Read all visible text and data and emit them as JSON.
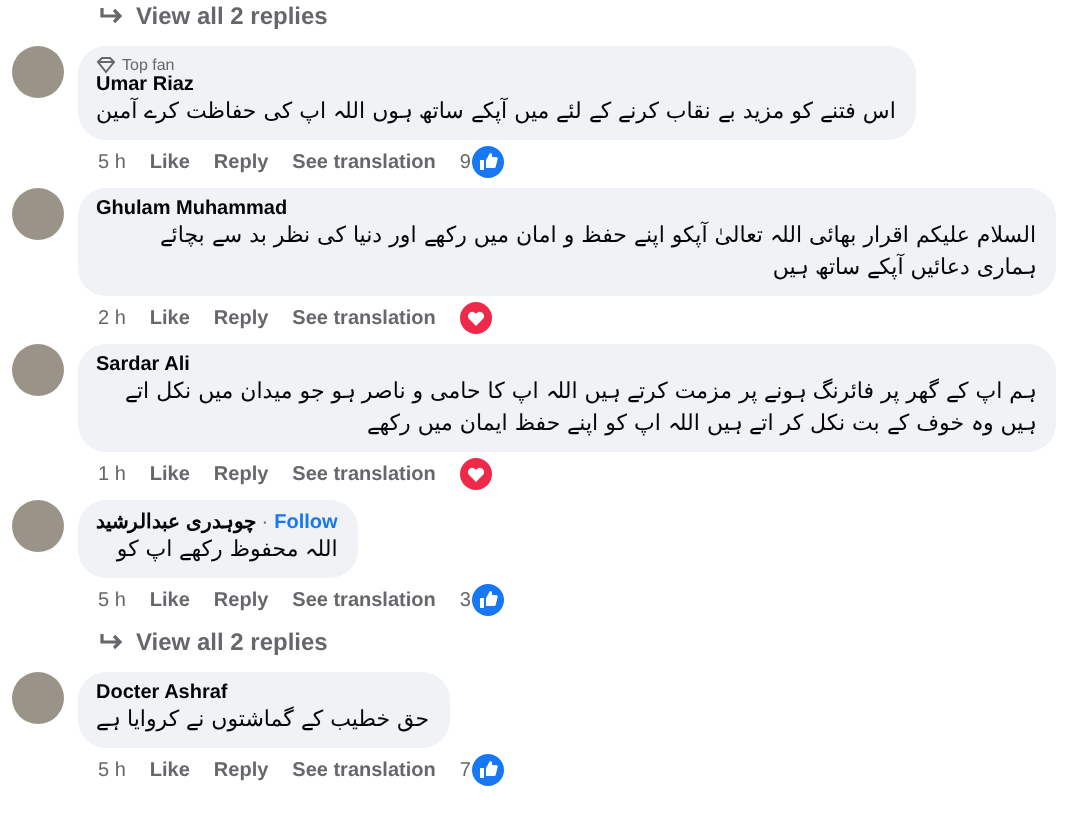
{
  "items": [
    {
      "kind": "replies_link",
      "label": "View all 2 replies"
    },
    {
      "kind": "comment",
      "badge": "Top fan",
      "author": "Umar Riaz",
      "text": "اس فتنے کو مزید بے نقاب کرنے کے لئے میں آپکے ساتھ ہوں اللہ اپ کی حفاظت کرے آمین",
      "time": "5 h",
      "actions": [
        "Like",
        "Reply",
        "See translation"
      ],
      "reaction": {
        "kind": "like",
        "count": "9"
      }
    },
    {
      "kind": "comment",
      "author": "Ghulam Muhammad",
      "text": "السلام علیکم اقرار بھائی اللہ تعالیٰ آپکو اپنے حفظ و امان میں رکھے اور دنیا کی نظر بد سے بچائے ہماری دعائیں آپکے ساتھ ہیں",
      "time": "2 h",
      "actions": [
        "Like",
        "Reply",
        "See translation"
      ],
      "reaction": {
        "kind": "love"
      }
    },
    {
      "kind": "comment",
      "author": "Sardar Ali",
      "text": "ہم اپ کے گھر پر فائرنگ ہونے پر مزمت کرتے ہیں اللہ اپ کا حامی و ناصر ہو جو میدان میں نکل اتے ہیں وہ خوف کے بت نکل کر اتے ہیں اللہ اپ کو اپنے حفظ ایمان میں رکھے",
      "time": "1 h",
      "actions": [
        "Like",
        "Reply",
        "See translation"
      ],
      "reaction": {
        "kind": "love"
      }
    },
    {
      "kind": "comment",
      "author": "چوہدری عبدالرشید",
      "separator": "·",
      "follow": "Follow",
      "text": "اللہ محفوظ رکھے اپ کو",
      "time": "5 h",
      "actions": [
        "Like",
        "Reply",
        "See translation"
      ],
      "reaction": {
        "kind": "like",
        "count": "3"
      }
    },
    {
      "kind": "replies_link",
      "label": "View all 2 replies"
    },
    {
      "kind": "comment",
      "author": "Docter Ashraf",
      "text": "حق خطیب کے گماشتوں نے کروایا ہے",
      "time": "5 h",
      "actions": [
        "Like",
        "Reply",
        "See translation"
      ],
      "reaction": {
        "kind": "like",
        "count": "7"
      }
    }
  ]
}
